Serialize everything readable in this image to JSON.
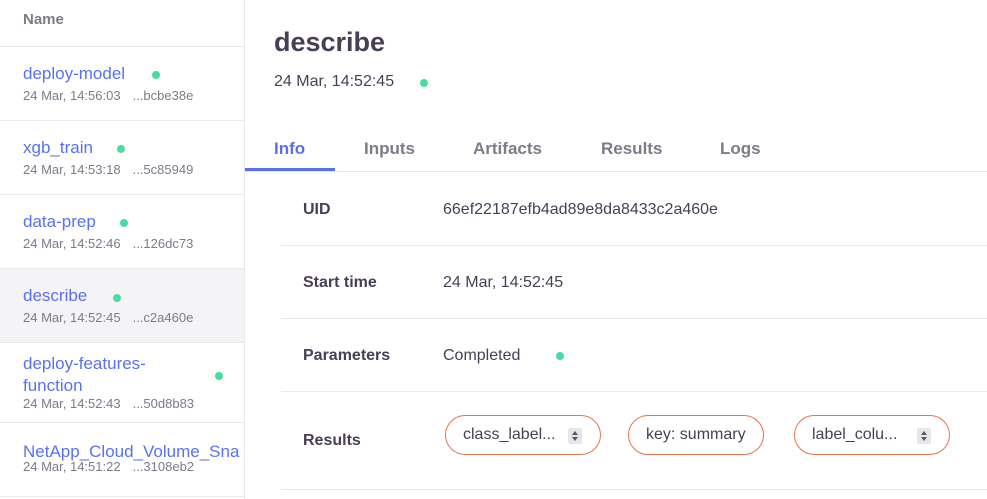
{
  "sidebar": {
    "header": "Name",
    "items": [
      {
        "title": "deploy-model",
        "date": "24 Mar, 14:56:03",
        "uid": "...bcbe38e"
      },
      {
        "title": "xgb_train",
        "date": "24 Mar, 14:53:18",
        "uid": "...5c85949"
      },
      {
        "title": "data-prep",
        "date": "24 Mar, 14:52:46",
        "uid": "...126dc73"
      },
      {
        "title": "describe",
        "date": "24 Mar, 14:52:45",
        "uid": "...c2a460e"
      },
      {
        "title": "deploy-features-function",
        "date": "24 Mar, 14:52:43",
        "uid": "...50d8b83"
      },
      {
        "title": "NetApp_Cloud_Volume_Sna",
        "date": "24 Mar, 14:51:22",
        "uid": "...3108eb2"
      }
    ]
  },
  "main": {
    "title": "describe",
    "date": "24 Mar, 14:52:45",
    "tabs": [
      "Info",
      "Inputs",
      "Artifacts",
      "Results",
      "Logs"
    ],
    "info": {
      "uid_label": "UID",
      "uid_value": "66ef22187efb4ad89e8da8433c2a460e",
      "start_label": "Start time",
      "start_value": "24 Mar, 14:52:45",
      "params_label": "Parameters",
      "params_value": "Completed",
      "results_label": "Results",
      "results_chips": [
        "class_label...",
        "key: summary",
        "label_colu..."
      ]
    }
  },
  "colors": {
    "accent": "#5871f4",
    "status_ok": "#49dba0",
    "chip_border": "#e2764f"
  }
}
